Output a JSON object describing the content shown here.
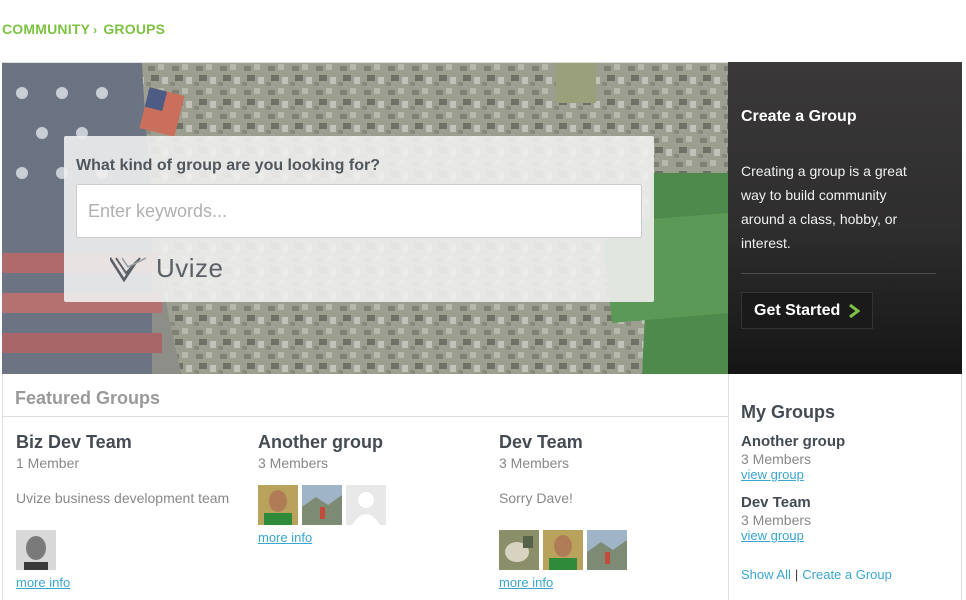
{
  "breadcrumb": {
    "items": [
      "COMMUNITY",
      "GROUPS"
    ],
    "separator": "›"
  },
  "hero": {
    "search_label": "What kind of group are you looking for?",
    "search_placeholder": "Enter keywords...",
    "logo_text": "Uvize"
  },
  "create": {
    "title": "Create a Group",
    "description": "Creating a group is a great way to build community around a class, hobby, or interest.",
    "button_label": "Get Started"
  },
  "featured": {
    "title": "Featured Groups",
    "groups": [
      {
        "name": "Biz Dev Team",
        "members": "1 Member",
        "description": "Uvize business development team",
        "link": "more info"
      },
      {
        "name": "Another group",
        "members": "3 Members",
        "description": "",
        "link": "more info"
      },
      {
        "name": "Dev Team",
        "members": "3 Members",
        "description": "Sorry Dave!",
        "link": "more info"
      }
    ]
  },
  "my_groups": {
    "title": "My Groups",
    "items": [
      {
        "name": "Another group",
        "members": "3 Members",
        "link": "view group"
      },
      {
        "name": "Dev Team",
        "members": "3 Members",
        "link": "view group"
      }
    ],
    "show_all": "Show All",
    "separator": "|",
    "create_link": "Create a Group"
  },
  "colors": {
    "brand_green": "#7dc242",
    "link_blue": "#3aa6d0",
    "dark_panel": "#2e2d2d"
  }
}
